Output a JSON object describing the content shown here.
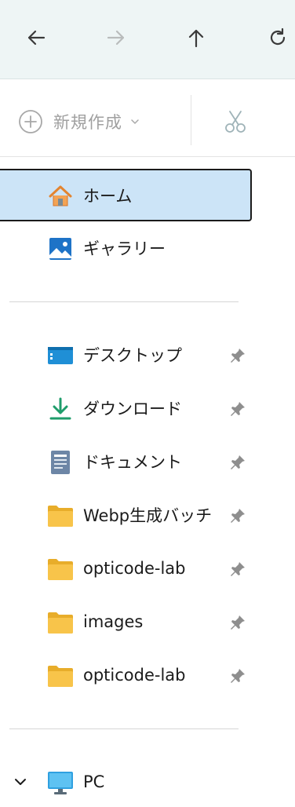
{
  "toolbar": {
    "new_label": "新規作成"
  },
  "sidebar": {
    "items": [
      {
        "label": "ホーム"
      },
      {
        "label": "ギャラリー"
      },
      {
        "label": "デスクトップ"
      },
      {
        "label": "ダウンロード"
      },
      {
        "label": "ドキュメント"
      },
      {
        "label": "Webp生成バッチ"
      },
      {
        "label": "opticode-lab"
      },
      {
        "label": "images"
      },
      {
        "label": "opticode-lab"
      },
      {
        "label": "PC"
      }
    ]
  },
  "colors": {
    "titlebar_bg": "#eef5f5",
    "selected_bg": "#cce4f7",
    "folder_yellow": "#f8c44a",
    "download_green": "#1f9d6b",
    "home_orange": "#e3842f"
  }
}
